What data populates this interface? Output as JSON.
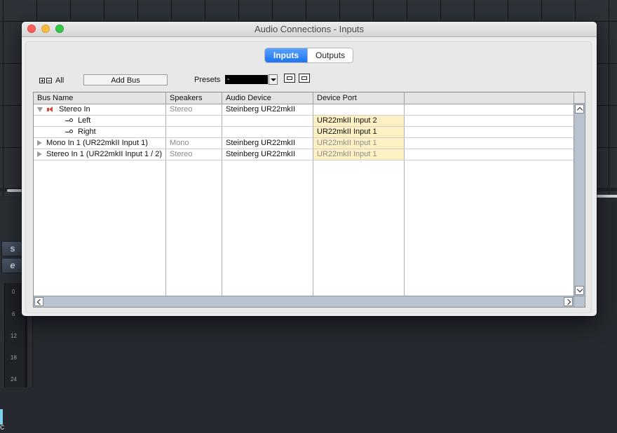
{
  "window": {
    "title": "Audio Connections - Inputs"
  },
  "tabs": [
    {
      "label": "Inputs",
      "active": true
    },
    {
      "label": "Outputs",
      "active": false
    }
  ],
  "toolbar": {
    "expand_all_label": "All",
    "add_bus_label": "Add Bus",
    "presets_label": "Presets",
    "presets_value": "-"
  },
  "table": {
    "columns": [
      "Bus Name",
      "Speakers",
      "Audio Device",
      "Device Port"
    ],
    "rows": [
      {
        "bus_name": "Stereo In",
        "speakers": "Stereo",
        "audio_device": "Steinberg UR22mkII",
        "device_port": "",
        "type": "bus",
        "expanded": true,
        "icon": "speaker-icon"
      },
      {
        "bus_name": "Left",
        "speakers": "",
        "audio_device": "",
        "device_port": "UR22mkII Input 2",
        "type": "channel"
      },
      {
        "bus_name": "Right",
        "speakers": "",
        "audio_device": "",
        "device_port": "UR22mkII Input 1",
        "type": "channel"
      },
      {
        "bus_name": "Mono In 1 (UR22mkII Input 1)",
        "speakers": "Mono",
        "audio_device": "Steinberg UR22mkII",
        "device_port": "UR22mkII Input 1",
        "type": "bus",
        "expanded": false
      },
      {
        "bus_name": "Stereo In 1 (UR22mkII Input 1 / 2)",
        "speakers": "Stereo",
        "audio_device": "Steinberg UR22mkII",
        "device_port": "UR22mkII Input 1",
        "type": "bus",
        "expanded": false
      }
    ]
  },
  "background": {
    "track_buttons": [
      "s",
      "e"
    ],
    "meter_ticks": [
      "0",
      "6",
      "12",
      "18",
      "24"
    ],
    "partial_label": "c"
  },
  "colors": {
    "accent": "#1c74f0",
    "port_highlight": "#fdf0c3",
    "close": "#fc605c",
    "minimize": "#fdbc40",
    "maximize": "#34c84a"
  }
}
